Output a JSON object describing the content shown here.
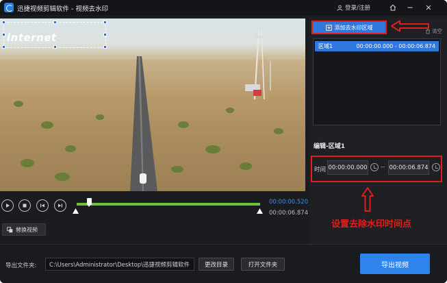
{
  "titlebar": {
    "title": "迅捷视频剪辑软件 - 视频去水印",
    "login": "登录/注册",
    "icons": [
      "app-logo",
      "user-icon",
      "home-icon",
      "minimize-icon",
      "close-icon"
    ]
  },
  "preview": {
    "watermark_text": "internet"
  },
  "player": {
    "current_time": "00:00:00.520",
    "total_time": "00:00:06.874",
    "controls": [
      "play-icon",
      "stop-icon",
      "prev-frame-icon",
      "next-frame-icon"
    ],
    "progress_color": "#6dc23b",
    "replace_video_label": "替换视频"
  },
  "regions": {
    "add_button_label": "添加去水印区域",
    "clear_label": "清空",
    "items": [
      {
        "name": "区域1",
        "range": "00:00:00.000 - 00:00:06.874"
      }
    ]
  },
  "editor": {
    "title": "编辑-区域1",
    "time_label": "时间",
    "start_time": "00:00:00.000",
    "separator": "--",
    "end_time": "00:00:06.874"
  },
  "annotation": {
    "text": "设置去除水印时间点",
    "color": "#e01e1e"
  },
  "output": {
    "label": "导出文件夹:",
    "path": "C:\\Users\\Administrator\\Desktop\\迅捷视频剪辑软件",
    "change_dir_label": "更改目录",
    "open_folder_label": "打开文件夹",
    "export_label": "导出视频"
  },
  "colors": {
    "accent": "#2f78de",
    "background": "#1b1c1f"
  }
}
